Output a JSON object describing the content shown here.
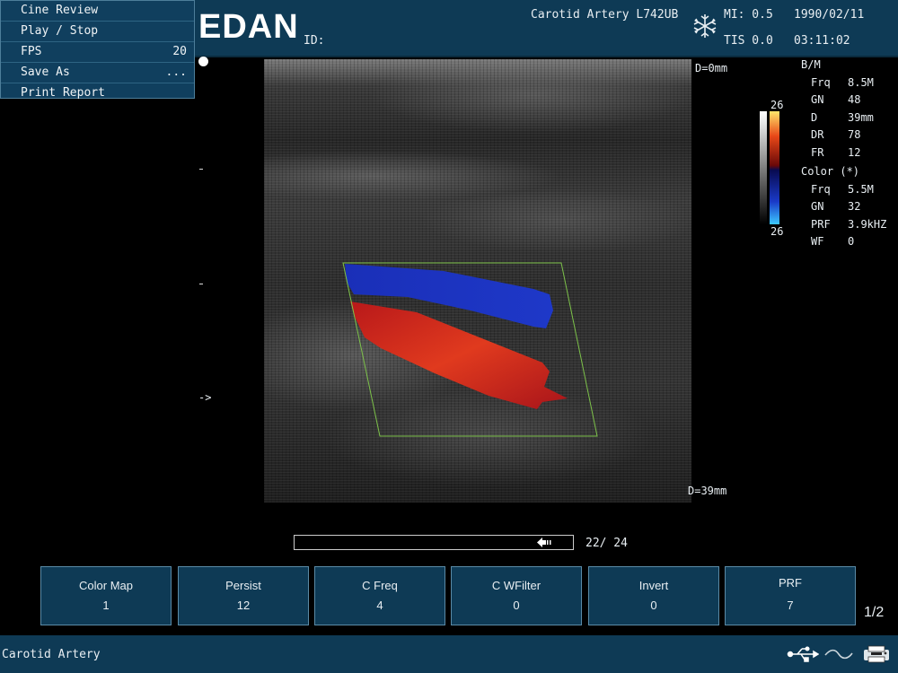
{
  "header": {
    "logo": "EDAN",
    "id_label": "ID:",
    "probe": "Carotid  Artery L742UB",
    "mi": "MI: 0.5",
    "tis": "TIS 0.0",
    "date": "1990/02/11",
    "time": "03:11:02",
    "freeze_icon": "snowflake-icon"
  },
  "menu": {
    "items": [
      {
        "label": "Cine Review",
        "value": ""
      },
      {
        "label": "Play / Stop",
        "value": ""
      },
      {
        "label": "FPS",
        "value": "20"
      },
      {
        "label": "Save As",
        "value": "..."
      },
      {
        "label": "Print Report",
        "value": ""
      }
    ]
  },
  "image": {
    "depth_top": "D=0mm",
    "depth_bottom": "D=39mm",
    "focus_marker": "->"
  },
  "colorbar": {
    "top_value": "26",
    "bottom_value": "26"
  },
  "params": {
    "bm_header": "B/M",
    "bm": [
      {
        "key": "Frq",
        "value": "8.5M"
      },
      {
        "key": "GN",
        "value": "48"
      },
      {
        "key": "D",
        "value": "39mm"
      },
      {
        "key": "DR",
        "value": "78"
      },
      {
        "key": "FR",
        "value": "12"
      }
    ],
    "color_header": "Color (*)",
    "color": [
      {
        "key": "Frq",
        "value": "5.5M"
      },
      {
        "key": "GN",
        "value": "32"
      },
      {
        "key": "PRF",
        "value": "3.9kHZ"
      },
      {
        "key": "WF",
        "value": "0"
      }
    ]
  },
  "cine": {
    "frame_count": "22/ 24",
    "progress": 0.92
  },
  "softkeys": [
    {
      "label": "Color Map",
      "value": "1"
    },
    {
      "label": "Persist",
      "value": "12"
    },
    {
      "label": "C Freq",
      "value": "4"
    },
    {
      "label": "C WFilter",
      "value": "0"
    },
    {
      "label": "Invert",
      "value": "0"
    },
    {
      "label": "PRF",
      "value": "7"
    }
  ],
  "page_indicator": "1/2",
  "status": {
    "exam": "Carotid  Artery",
    "icons": [
      "usb-icon",
      "wave-icon",
      "printer-icon"
    ]
  }
}
